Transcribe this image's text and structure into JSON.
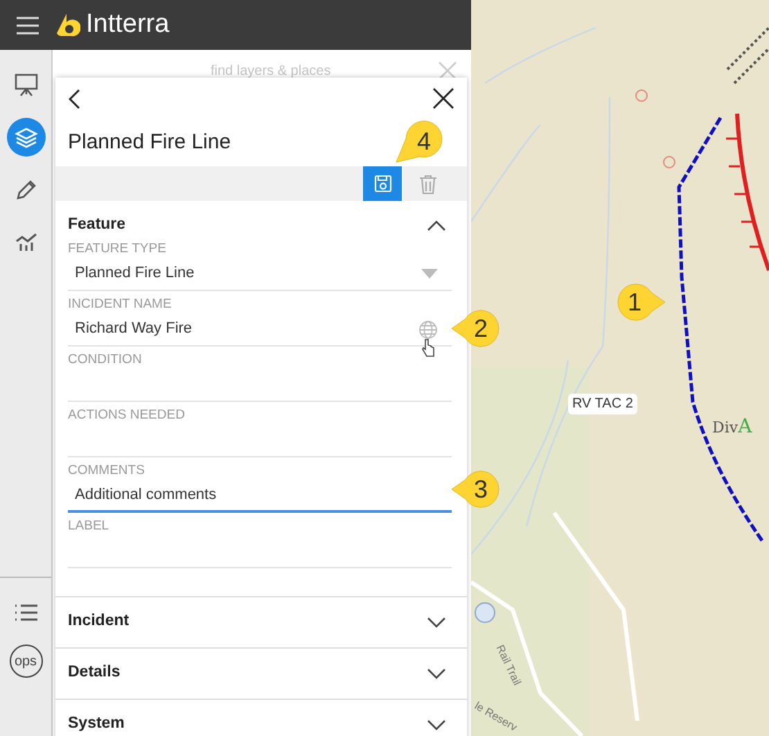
{
  "app": {
    "title": "Intterra"
  },
  "rail": {
    "items": [
      {
        "kind": "presentation",
        "selected": false
      },
      {
        "kind": "layers",
        "selected": true
      },
      {
        "kind": "edit",
        "selected": false
      },
      {
        "kind": "chart",
        "selected": false
      }
    ],
    "bottom": [
      {
        "kind": "list"
      },
      {
        "kind": "ops",
        "label": "ops"
      }
    ]
  },
  "search": {
    "placeholder": "find layers & places"
  },
  "panel": {
    "title": "Planned Fire Line",
    "toolbar": [
      {
        "kind": "save",
        "selected": true
      },
      {
        "kind": "delete",
        "selected": false
      }
    ],
    "sections": [
      {
        "title": "Feature",
        "expanded": true,
        "fields": [
          {
            "label": "FEATURE TYPE",
            "kind": "select",
            "value": "Planned Fire Line",
            "focused": false
          },
          {
            "label": "INCIDENT NAME",
            "kind": "lookup",
            "value": "Richard Way Fire",
            "focused": false
          },
          {
            "label": "CONDITION",
            "kind": "text",
            "focused": false
          },
          {
            "label": "ACTIONS NEEDED",
            "kind": "text",
            "focused": false
          },
          {
            "label": "COMMENTS",
            "kind": "text",
            "value": "Additional comments",
            "focused": true
          },
          {
            "label": "LABEL",
            "kind": "text",
            "focused": false
          }
        ]
      },
      {
        "title": "Incident",
        "expanded": false
      },
      {
        "title": "Details",
        "expanded": false
      },
      {
        "title": "System",
        "expanded": false
      }
    ]
  },
  "map": {
    "labels": [
      {
        "kind": "tag",
        "text": "RV TAC 2"
      },
      {
        "kind": "division",
        "text": "Div",
        "letter": "A"
      },
      {
        "kind": "trail",
        "text": "Rail Trail"
      },
      {
        "kind": "road",
        "text": "le Reserv"
      }
    ]
  },
  "callouts": [
    {
      "text": "4"
    },
    {
      "text": "1"
    },
    {
      "text": "2"
    },
    {
      "text": "3"
    }
  ]
}
